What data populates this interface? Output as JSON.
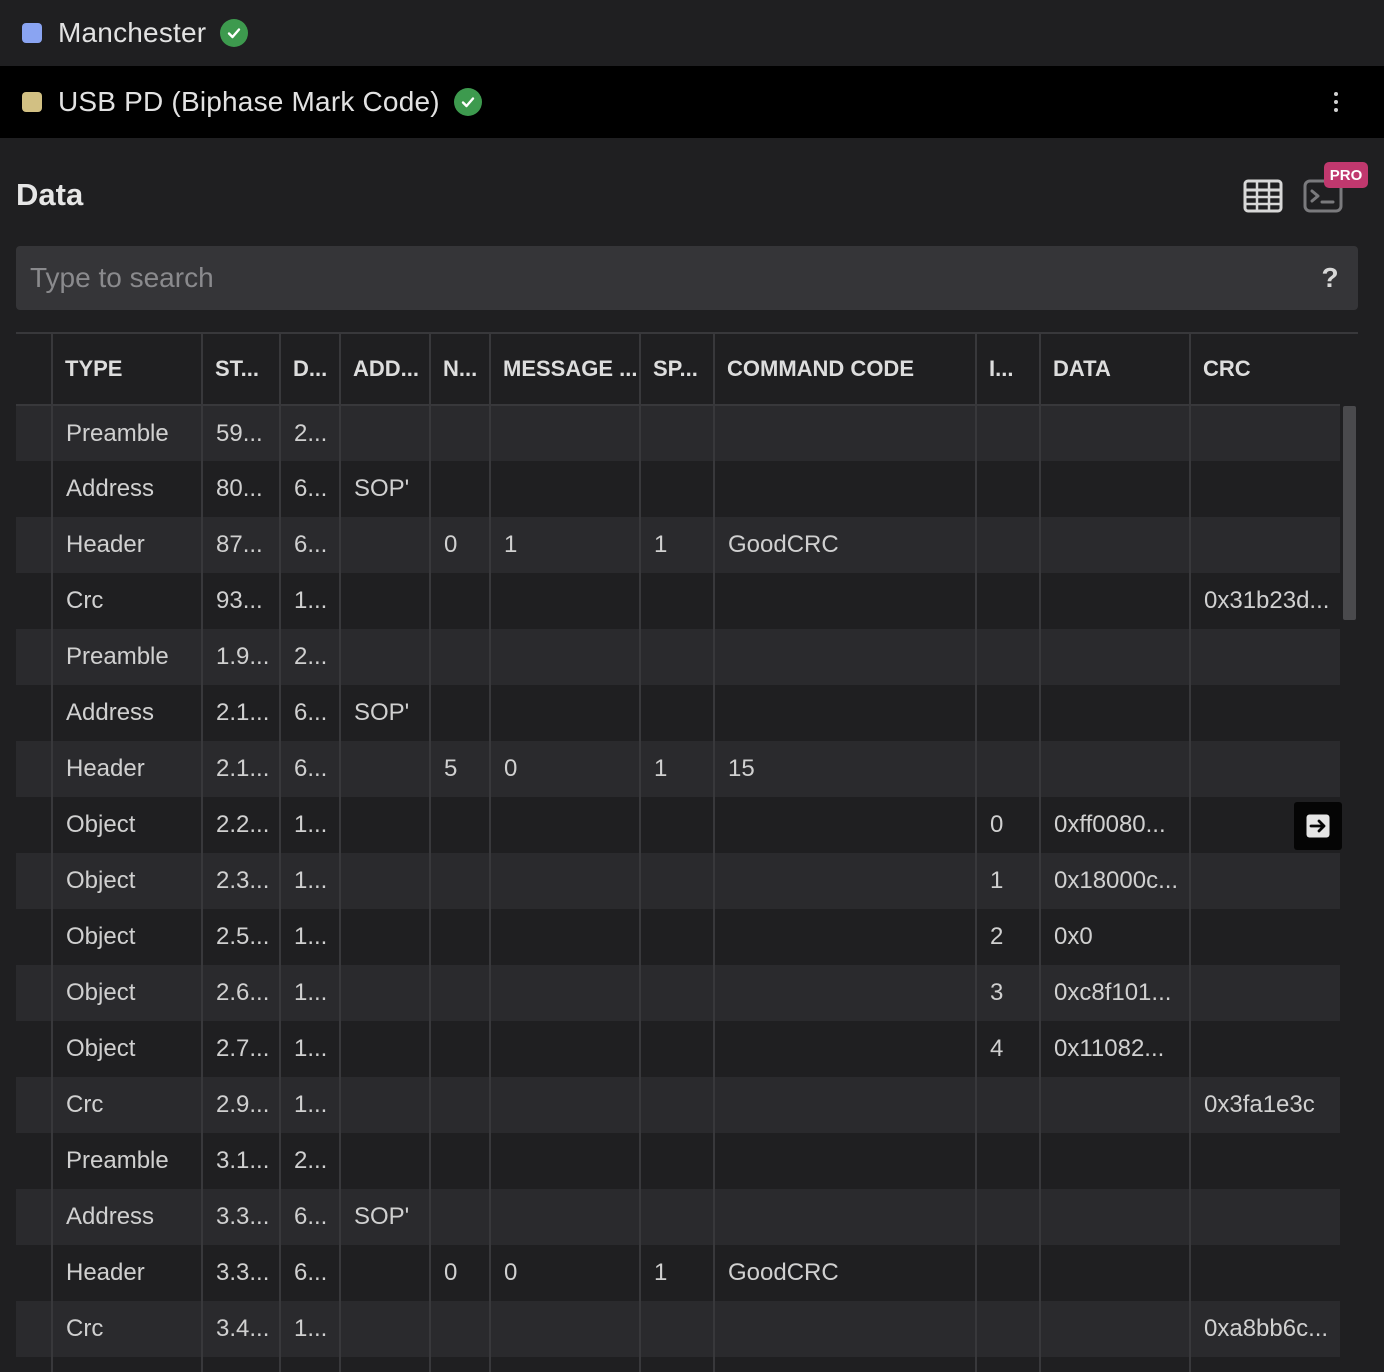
{
  "analyzers": [
    {
      "name": "Manchester",
      "color": "#8aa4f2",
      "status": "ok"
    },
    {
      "name": "USB PD (Biphase Mark Code)",
      "color": "#d2c083",
      "status": "ok"
    }
  ],
  "data_panel": {
    "title": "Data",
    "pro_badge": "PRO",
    "search": {
      "placeholder": "Type to search",
      "value": "",
      "help_label": "?"
    }
  },
  "table": {
    "columns": [
      "",
      "TYPE",
      "ST...",
      "D...",
      "ADD...",
      "N...",
      "MESSAGE ...",
      "SP...",
      "COMMAND CODE",
      "I...",
      "DATA",
      "CRC"
    ],
    "rows": [
      [
        "",
        "Preamble",
        "59...",
        "2...",
        "",
        "",
        "",
        "",
        "",
        "",
        "",
        ""
      ],
      [
        "",
        "Address",
        "80...",
        "6...",
        "SOP'",
        "",
        "",
        "",
        "",
        "",
        "",
        ""
      ],
      [
        "",
        "Header",
        "87...",
        "6...",
        "",
        "0",
        "1",
        "1",
        "GoodCRC",
        "",
        "",
        ""
      ],
      [
        "",
        "Crc",
        "93...",
        "1...",
        "",
        "",
        "",
        "",
        "",
        "",
        "",
        "0x31b23d..."
      ],
      [
        "",
        "Preamble",
        "1.9...",
        "2...",
        "",
        "",
        "",
        "",
        "",
        "",
        "",
        ""
      ],
      [
        "",
        "Address",
        "2.1...",
        "6...",
        "SOP'",
        "",
        "",
        "",
        "",
        "",
        "",
        ""
      ],
      [
        "",
        "Header",
        "2.1...",
        "6...",
        "",
        "5",
        "0",
        "1",
        "15",
        "",
        "",
        ""
      ],
      [
        "",
        "Object",
        "2.2...",
        "1...",
        "",
        "",
        "",
        "",
        "",
        "0",
        "0xff0080...",
        ""
      ],
      [
        "",
        "Object",
        "2.3...",
        "1...",
        "",
        "",
        "",
        "",
        "",
        "1",
        "0x18000c...",
        ""
      ],
      [
        "",
        "Object",
        "2.5...",
        "1...",
        "",
        "",
        "",
        "",
        "",
        "2",
        "0x0",
        ""
      ],
      [
        "",
        "Object",
        "2.6...",
        "1...",
        "",
        "",
        "",
        "",
        "",
        "3",
        "0xc8f101...",
        ""
      ],
      [
        "",
        "Object",
        "2.7...",
        "1...",
        "",
        "",
        "",
        "",
        "",
        "4",
        "0x11082...",
        ""
      ],
      [
        "",
        "Crc",
        "2.9...",
        "1...",
        "",
        "",
        "",
        "",
        "",
        "",
        "",
        "0x3fa1e3c"
      ],
      [
        "",
        "Preamble",
        "3.1...",
        "2...",
        "",
        "",
        "",
        "",
        "",
        "",
        "",
        ""
      ],
      [
        "",
        "Address",
        "3.3...",
        "6...",
        "SOP'",
        "",
        "",
        "",
        "",
        "",
        "",
        ""
      ],
      [
        "",
        "Header",
        "3.3...",
        "6...",
        "",
        "0",
        "0",
        "1",
        "GoodCRC",
        "",
        "",
        ""
      ],
      [
        "",
        "Crc",
        "3.4...",
        "1...",
        "",
        "",
        "",
        "",
        "",
        "",
        "",
        "0xa8bb6c..."
      ],
      [
        "",
        "",
        "",
        "",
        "",
        "",
        "",
        "",
        "",
        "",
        "",
        ""
      ]
    ]
  },
  "icons": {
    "status": "check-circle-icon",
    "menu": "kebab-menu-icon",
    "table_view": "grid-icon",
    "terminal_view": "terminal-icon",
    "row_action": "arrow-right-box-icon"
  }
}
